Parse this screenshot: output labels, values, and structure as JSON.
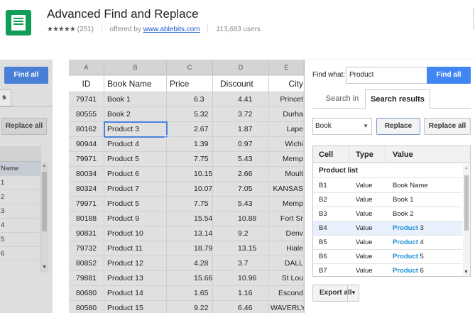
{
  "header": {
    "title": "Advanced Find and Replace",
    "stars": "★★★★★",
    "rating_count": "(251)",
    "offered_by_prefix": "offered by",
    "offered_by_link": "www.ablebits.com",
    "users": "113,683 users"
  },
  "left_panel": {
    "find_all_label": "Find all",
    "tab_fragment": "s",
    "replace_all_label": "Replace all",
    "list": [
      "Name",
      "1",
      "2",
      "3",
      "4",
      "5",
      "6"
    ]
  },
  "sheet": {
    "column_letters": [
      "A",
      "B",
      "C",
      "D",
      "E"
    ],
    "header_row": [
      "ID",
      "Book Name",
      "Price",
      "Discount",
      "City"
    ],
    "rows": [
      [
        "79741",
        "Book 1",
        "6.3",
        "4.41",
        "Princet"
      ],
      [
        "80555",
        "Book 2",
        "5.32",
        "3.72",
        "Durha"
      ],
      [
        "80162",
        "Product 3",
        "2.67",
        "1.87",
        "Lape"
      ],
      [
        "90944",
        "Product 4",
        "1.39",
        "0.97",
        "Wichi"
      ],
      [
        "79971",
        "Product 5",
        "7.75",
        "5.43",
        "Memp"
      ],
      [
        "80034",
        "Product 6",
        "10.15",
        "2.66",
        "Moult"
      ],
      [
        "80324",
        "Product 7",
        "10.07",
        "7.05",
        "KANSAS"
      ],
      [
        "79971",
        "Product 5",
        "7.75",
        "5.43",
        "Memp"
      ],
      [
        "80188",
        "Product 9",
        "15.54",
        "10.88",
        "Fort Sr"
      ],
      [
        "90831",
        "Product 10",
        "13.14",
        "9.2",
        "Denv"
      ],
      [
        "79732",
        "Product 11",
        "18.79",
        "13.15",
        "Hiale"
      ],
      [
        "80852",
        "Product 12",
        "4.28",
        "3.7",
        "DALL"
      ],
      [
        "79881",
        "Product 13",
        "15.66",
        "10.96",
        "St Lou"
      ],
      [
        "80680",
        "Product 14",
        "1.65",
        "1.16",
        "Escond"
      ],
      [
        "80580",
        "Product 15",
        "9.22",
        "6.46",
        "WAVERLY"
      ]
    ]
  },
  "panel": {
    "find_what_label": "Find what:",
    "find_what_value": "Product",
    "find_all_label": "Find all",
    "tabs": [
      "Search in",
      "Search results"
    ],
    "select_value": "Book",
    "replace_label": "Replace",
    "replace_all_label": "Replace all",
    "results_headers": [
      "Cell",
      "Type",
      "Value"
    ],
    "group_label": "Product list",
    "results": [
      {
        "cell": "B1",
        "type": "Value",
        "pre": "Book Name",
        "hl": ""
      },
      {
        "cell": "B2",
        "type": "Value",
        "pre": "Book 1",
        "hl": ""
      },
      {
        "cell": "B3",
        "type": "Value",
        "pre": "Book 2",
        "hl": ""
      },
      {
        "cell": "B4",
        "type": "Value",
        "hl": "Product",
        "post": " 3"
      },
      {
        "cell": "B5",
        "type": "Value",
        "hl": "Product",
        "post": " 4"
      },
      {
        "cell": "B6",
        "type": "Value",
        "hl": "Product",
        "post": " 5"
      },
      {
        "cell": "B7",
        "type": "Value",
        "hl": "Product",
        "post": " 6"
      }
    ],
    "export_label": "Export all"
  }
}
